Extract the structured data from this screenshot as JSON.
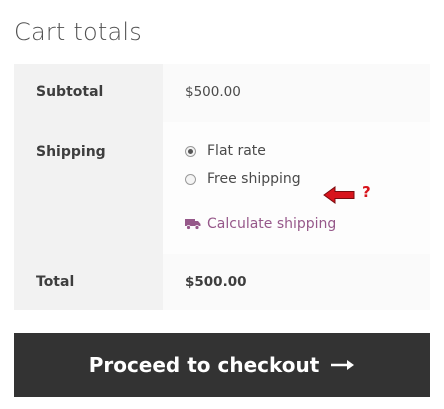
{
  "title": "Cart totals",
  "rows": {
    "subtotal": {
      "label": "Subtotal",
      "value": "$500.00"
    },
    "shipping": {
      "label": "Shipping",
      "options": [
        {
          "label": "Flat rate",
          "checked": true
        },
        {
          "label": "Free shipping",
          "checked": false
        }
      ],
      "calculate_label": "Calculate shipping",
      "annotation": "?"
    },
    "total": {
      "label": "Total",
      "value": "$500.00"
    }
  },
  "checkout": {
    "label": "Proceed to checkout"
  },
  "icons": {
    "truck": "truck-icon",
    "arrow": "arrow-right-icon",
    "annotation_arrow": "arrow-left-icon"
  },
  "colors": {
    "link": "#96588a",
    "button_bg": "#333333",
    "annotation": "#d8141c"
  }
}
